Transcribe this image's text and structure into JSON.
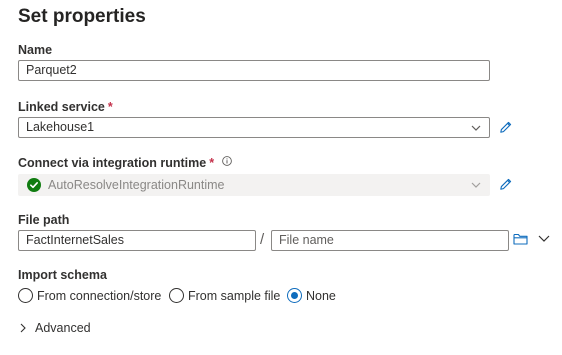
{
  "panel": {
    "title": "Set properties"
  },
  "fields": {
    "name": {
      "label": "Name",
      "value": "Parquet2"
    },
    "linked_service": {
      "label": "Linked service",
      "required_mark": "*",
      "value": "Lakehouse1"
    },
    "integration_runtime": {
      "label": "Connect via integration runtime",
      "required_mark": "*",
      "value": "AutoResolveIntegrationRuntime",
      "status_icon": "check-circle-icon",
      "status_color": "#107c10"
    },
    "file_path": {
      "label": "File path",
      "folder_value": "FactInternetSales",
      "separator": "/",
      "file_placeholder": "File name"
    },
    "import_schema": {
      "label": "Import schema",
      "options": [
        {
          "label": "From connection/store",
          "selected": false
        },
        {
          "label": "From sample file",
          "selected": false
        },
        {
          "label": "None",
          "selected": true
        }
      ]
    }
  },
  "advanced": {
    "label": "Advanced"
  },
  "colors": {
    "accent": "#0f6cbd",
    "required": "#c4314b",
    "success": "#107c10"
  }
}
